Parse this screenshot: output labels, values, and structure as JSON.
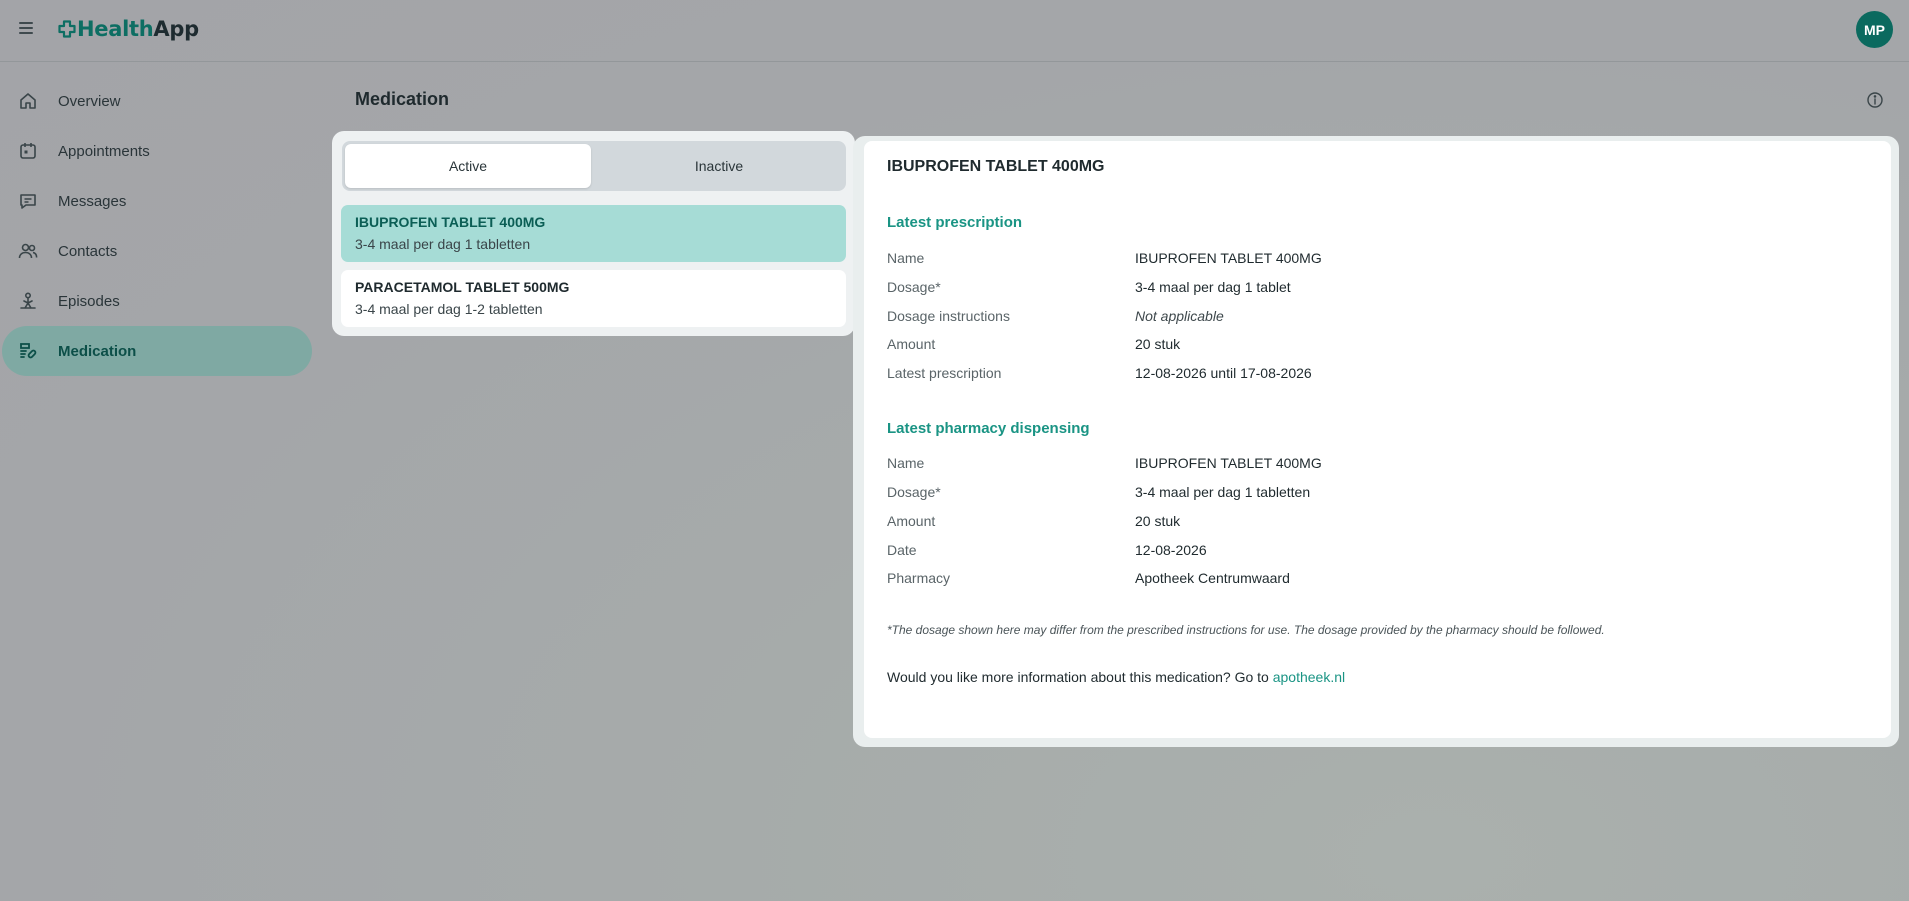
{
  "app": {
    "logo_part1": "Health",
    "logo_part2": "App",
    "avatar_initials": "MP"
  },
  "sidebar": {
    "items": [
      {
        "label": "Overview",
        "icon": "home-icon",
        "active": false
      },
      {
        "label": "Appointments",
        "icon": "calendar-icon",
        "active": false
      },
      {
        "label": "Messages",
        "icon": "chat-icon",
        "active": false
      },
      {
        "label": "Contacts",
        "icon": "people-icon",
        "active": false
      },
      {
        "label": "Episodes",
        "icon": "episode-icon",
        "active": false
      },
      {
        "label": "Medication",
        "icon": "pill-icon",
        "active": true
      }
    ]
  },
  "main": {
    "title": "Medication",
    "tabs": [
      {
        "label": "Active",
        "selected": true
      },
      {
        "label": "Inactive",
        "selected": false
      }
    ],
    "medications": [
      {
        "name": "IBUPROFEN TABLET 400MG",
        "dosage": "3-4 maal per dag 1 tabletten",
        "selected": true
      },
      {
        "name": "PARACETAMOL TABLET 500MG",
        "dosage": "3-4 maal per dag 1-2 tabletten",
        "selected": false
      }
    ]
  },
  "detail": {
    "title": "IBUPROFEN TABLET 400MG",
    "prescription": {
      "heading": "Latest prescription",
      "rows": [
        {
          "label": "Name",
          "value": "IBUPROFEN TABLET 400MG"
        },
        {
          "label": "Dosage*",
          "value": "3-4 maal per dag 1 tablet"
        },
        {
          "label": "Dosage instructions",
          "value": "Not applicable"
        },
        {
          "label": "Amount",
          "value": "20 stuk"
        },
        {
          "label": "Latest prescription",
          "value": "12-08-2026 until 17-08-2026"
        }
      ]
    },
    "dispensing": {
      "heading": "Latest pharmacy dispensing",
      "rows": [
        {
          "label": "Name",
          "value": "IBUPROFEN TABLET 400MG"
        },
        {
          "label": "Dosage*",
          "value": "3-4 maal per dag 1 tabletten"
        },
        {
          "label": "Amount",
          "value": "20 stuk"
        },
        {
          "label": "Date",
          "value": "12-08-2026"
        },
        {
          "label": "Pharmacy",
          "value": "Apotheek Centrumwaard"
        }
      ]
    },
    "footnote": "*The dosage shown here may differ from the prescribed instructions for use. The dosage provided by the pharmacy should be followed.",
    "more_info_text": "Would you like more information about this medication? Go to ",
    "more_info_link": "apotheek.nl"
  },
  "colors": {
    "brand": "#0b6a5f",
    "accent": "#1a9484",
    "selected_item": "#a6dcd6",
    "active_nav": "#7fa9a3"
  }
}
